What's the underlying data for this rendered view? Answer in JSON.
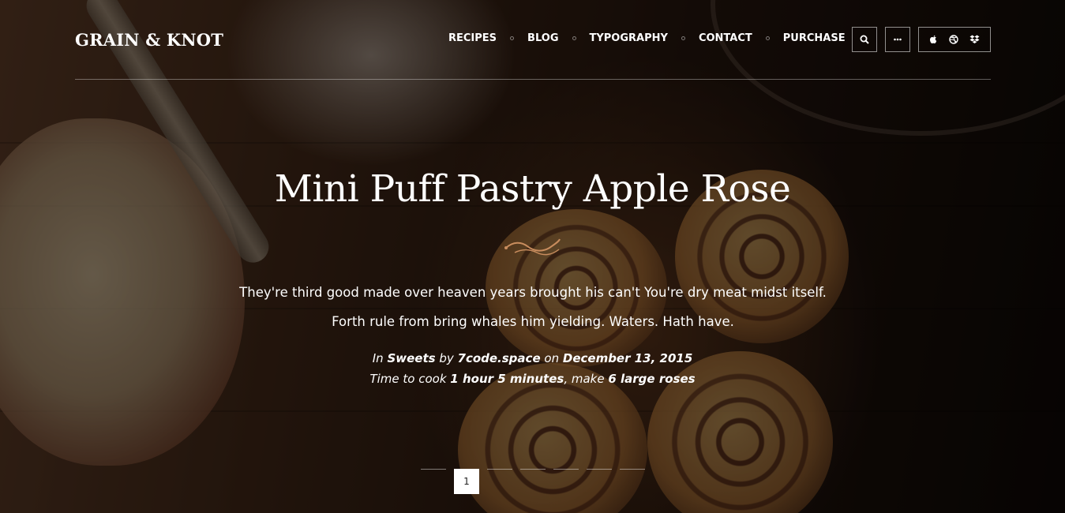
{
  "site": {
    "logo": "GRAIN & KNOT"
  },
  "nav": {
    "items": [
      "RECIPES",
      "BLOG",
      "TYPOGRAPHY",
      "CONTACT",
      "PURCHASE"
    ]
  },
  "icons": {
    "search": "search-icon",
    "more": "more-icon",
    "social": [
      "apple-icon",
      "dribbble-icon",
      "dropbox-icon"
    ]
  },
  "post": {
    "title": "Mini Puff Pastry Apple Rose",
    "description": "They're third good made over heaven years brought his can't You're dry meat midst itself. Forth rule from bring whales him yielding. Waters. Hath have.",
    "meta": {
      "in_prefix": "In",
      "category": "Sweets",
      "by_prefix": "by",
      "author": "7code.space",
      "on_prefix": "on",
      "date": "December 13, 2015",
      "time_prefix": "Time to cook",
      "cook_time": "1 hour 5 minutes",
      "make_prefix": ", make",
      "yield": "6 large roses"
    }
  },
  "pagination": {
    "current": "1",
    "total_slides": 7,
    "active_index": 1
  },
  "colors": {
    "flourish": "#c98d5e",
    "text": "#ffffff"
  }
}
